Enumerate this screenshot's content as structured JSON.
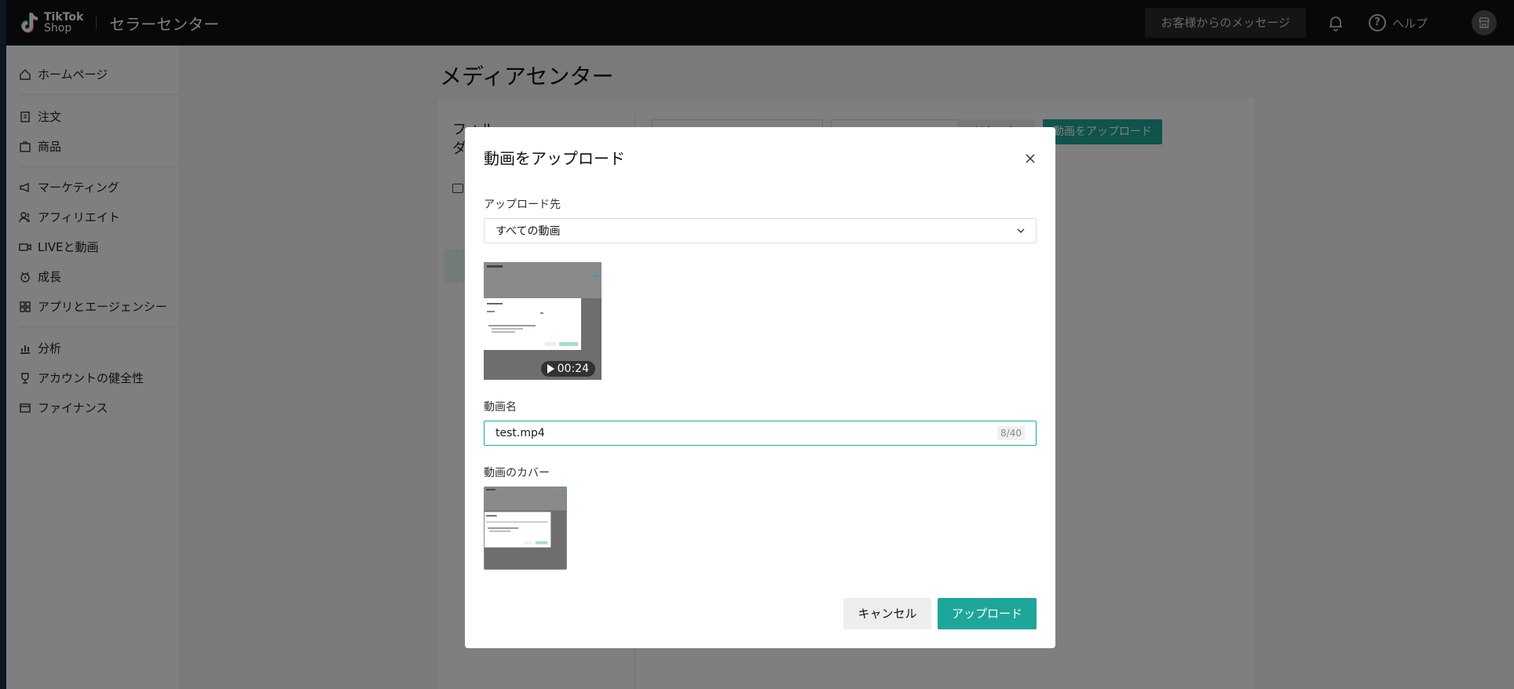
{
  "header": {
    "logo_line1": "TikTok",
    "logo_line2": "Shop",
    "center_title": "セラーセンター",
    "messages_label": "お客様からのメッセージ",
    "help_label": "ヘルプ"
  },
  "sidebar": {
    "items": [
      {
        "label": "ホームページ",
        "icon": "home-icon"
      },
      {
        "label": "注文",
        "icon": "order-icon"
      },
      {
        "label": "商品",
        "icon": "product-icon"
      },
      {
        "label": "マーケティング",
        "icon": "megaphone-icon"
      },
      {
        "label": "アフィリエイト",
        "icon": "affiliate-icon"
      },
      {
        "label": "LIVEと動画",
        "icon": "live-icon"
      },
      {
        "label": "成長",
        "icon": "growth-icon"
      },
      {
        "label": "アプリとエージェンシー",
        "icon": "apps-icon"
      },
      {
        "label": "分析",
        "icon": "analytics-icon"
      },
      {
        "label": "アカウントの健全性",
        "icon": "trophy-icon"
      },
      {
        "label": "ファイナンス",
        "icon": "wallet-icon"
      }
    ]
  },
  "main": {
    "page_title": "メディアセンター",
    "folder_title": "フォルダ",
    "reset_label": "リセット",
    "upload_video_label": "動画をアップロード"
  },
  "modal": {
    "title": "動画をアップロード",
    "destination_label": "アップロード先",
    "destination_value": "すべての動画",
    "duration": "00:24",
    "name_label": "動画名",
    "name_value": "test.mp4",
    "name_count": "8/40",
    "cover_label": "動画のカバー",
    "cancel_label": "キャンセル",
    "upload_label": "アップロード"
  },
  "colors": {
    "accent": "#1ea69a",
    "topbar": "#111111"
  }
}
